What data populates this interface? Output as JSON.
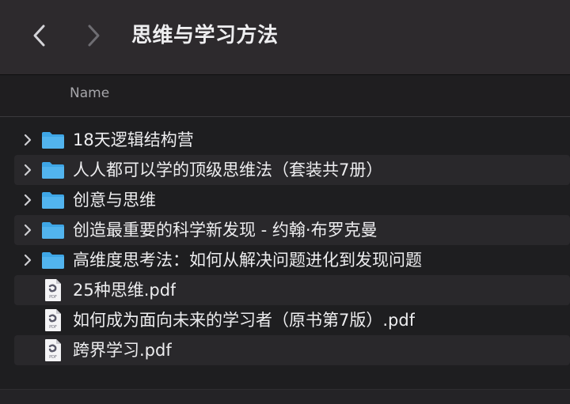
{
  "window": {
    "title": "思维与学习方法"
  },
  "navigation": {
    "back_icon": "chevron-left-icon",
    "forward_icon": "chevron-right-icon"
  },
  "columns": {
    "name_label": "Name"
  },
  "colors": {
    "folder": "#3ea6e6",
    "pdf_accent": "#5a5a6a",
    "selection_row": "#29282b",
    "background": "#1e1e20"
  },
  "files": [
    {
      "name": "18天逻辑结构营",
      "kind": "folder",
      "icon": "folder-icon"
    },
    {
      "name": "人人都可以学的顶级思维法（套装共7册）",
      "kind": "folder",
      "icon": "folder-icon"
    },
    {
      "name": "创意与思维",
      "kind": "folder",
      "icon": "folder-icon"
    },
    {
      "name": "创造最重要的科学新发现 - 约翰·布罗克曼",
      "kind": "folder",
      "icon": "folder-icon"
    },
    {
      "name": "高维度思考法：如何从解决问题进化到发现问题",
      "kind": "folder",
      "icon": "folder-icon"
    },
    {
      "name": "25种思维.pdf",
      "kind": "pdf",
      "icon": "pdf-file-icon",
      "icon_label": "PDF"
    },
    {
      "name": "如何成为面向未来的学习者（原书第7版）.pdf",
      "kind": "pdf",
      "icon": "pdf-file-icon",
      "icon_label": "PDF"
    },
    {
      "name": "跨界学习.pdf",
      "kind": "pdf",
      "icon": "pdf-file-icon",
      "icon_label": "PDF"
    }
  ]
}
